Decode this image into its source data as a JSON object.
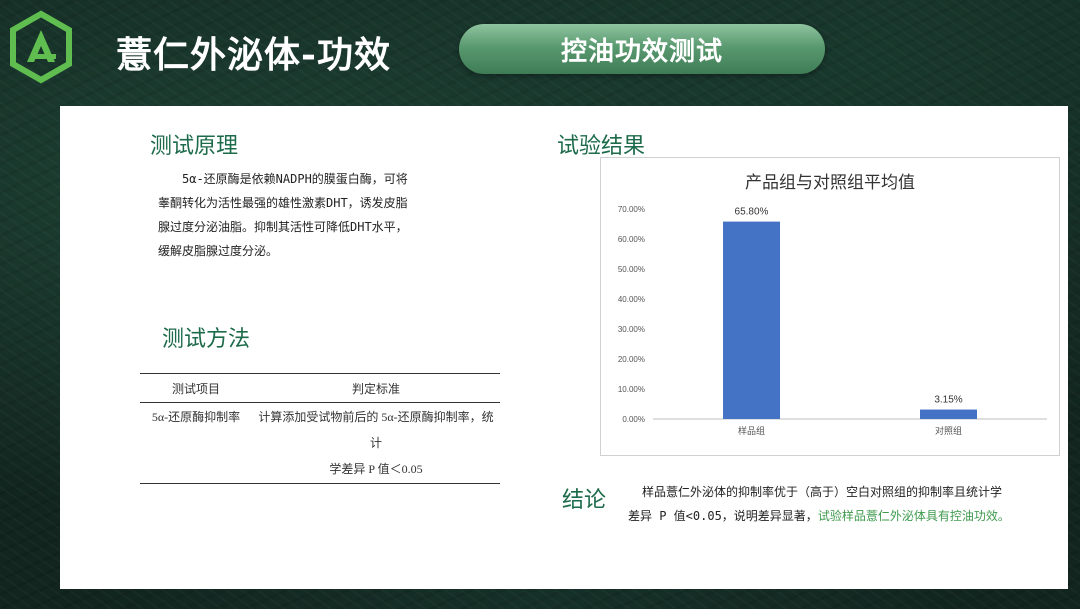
{
  "header": {
    "title": "薏仁外泌体-功效",
    "pill_label": "控油功效测试"
  },
  "colors": {
    "accent_green": "#1d6b4a",
    "bar_blue": "#4472c4",
    "highlight_green": "#3f9a4e"
  },
  "principle": {
    "heading": "测试原理",
    "lines": [
      "5α-还原酶是依赖NADPH的膜蛋白酶，可将",
      "睾酮转化为活性最强的雄性激素DHT，诱发皮脂",
      "腺过度分泌油脂。抑制其活性可降低DHT水平，",
      "缓解皮脂腺过度分泌。"
    ]
  },
  "method": {
    "heading": "测试方法",
    "table": {
      "headers": [
        "测试项目",
        "判定标准"
      ],
      "rows": [
        {
          "item": "5α-还原酶抑制率",
          "criteria_line1": "计算添加受试物前后的 5α-还原酶抑制率，统计",
          "criteria_line2": "学差异 P 值＜0.05"
        }
      ]
    }
  },
  "results": {
    "heading": "试验结果"
  },
  "chart_data": {
    "type": "bar",
    "title": "产品组与对照组平均值",
    "categories": [
      "样品组",
      "对照组"
    ],
    "values": [
      65.8,
      3.15
    ],
    "data_labels": [
      "65.80%",
      "3.15%"
    ],
    "ylim": [
      0,
      70
    ],
    "yticks": [
      "0.00%",
      "10.00%",
      "20.00%",
      "30.00%",
      "40.00%",
      "50.00%",
      "60.00%",
      "70.00%"
    ],
    "grid": false,
    "xlabel": "",
    "ylabel": ""
  },
  "conclusion": {
    "heading": "结论",
    "line1": "样品薏仁外泌体的抑制率优于（高于）空白对照组的抑制率且统计学",
    "line2_plain": "差异 P 值<0.05，说明差异显著，",
    "line2_highlight": "试验样品薏仁外泌体具有控油功效。"
  }
}
